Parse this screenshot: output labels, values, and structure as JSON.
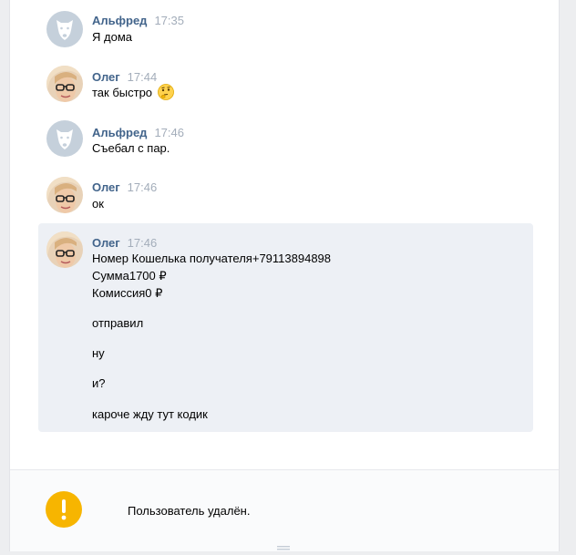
{
  "messages": [
    {
      "author": "Альфред",
      "time": "17:35",
      "lines": [
        "Я дома"
      ],
      "avatar": "dog-avatar"
    },
    {
      "author": "Олег",
      "time": "17:44",
      "lines": [
        "так быстро"
      ],
      "emoji": "thinking-face-emoji",
      "avatar": "user-photo-avatar"
    },
    {
      "author": "Альфред",
      "time": "17:46",
      "lines": [
        "Съебал с пар."
      ],
      "avatar": "dog-avatar"
    },
    {
      "author": "Олег",
      "time": "17:46",
      "lines": [
        "ок"
      ],
      "avatar": "user-photo-avatar"
    },
    {
      "author": "Олег",
      "time": "17:46",
      "selected": true,
      "avatar": "user-photo-avatar",
      "lines": [
        "Номер Кошелька получателя+79113894898",
        "Сумма1700 ₽",
        "Комиссия0 ₽",
        "отправил",
        "ну",
        "и?",
        "кароче жду тут кодик"
      ]
    }
  ],
  "footer": {
    "notice": "Пользователь удалён.",
    "icon": "exclamation-icon",
    "icon_color": "#f7b500"
  },
  "colors": {
    "author": "#42648b",
    "time": "#a3adba",
    "selected_bg": "#edf0f5",
    "page_bg": "#edeef0"
  }
}
